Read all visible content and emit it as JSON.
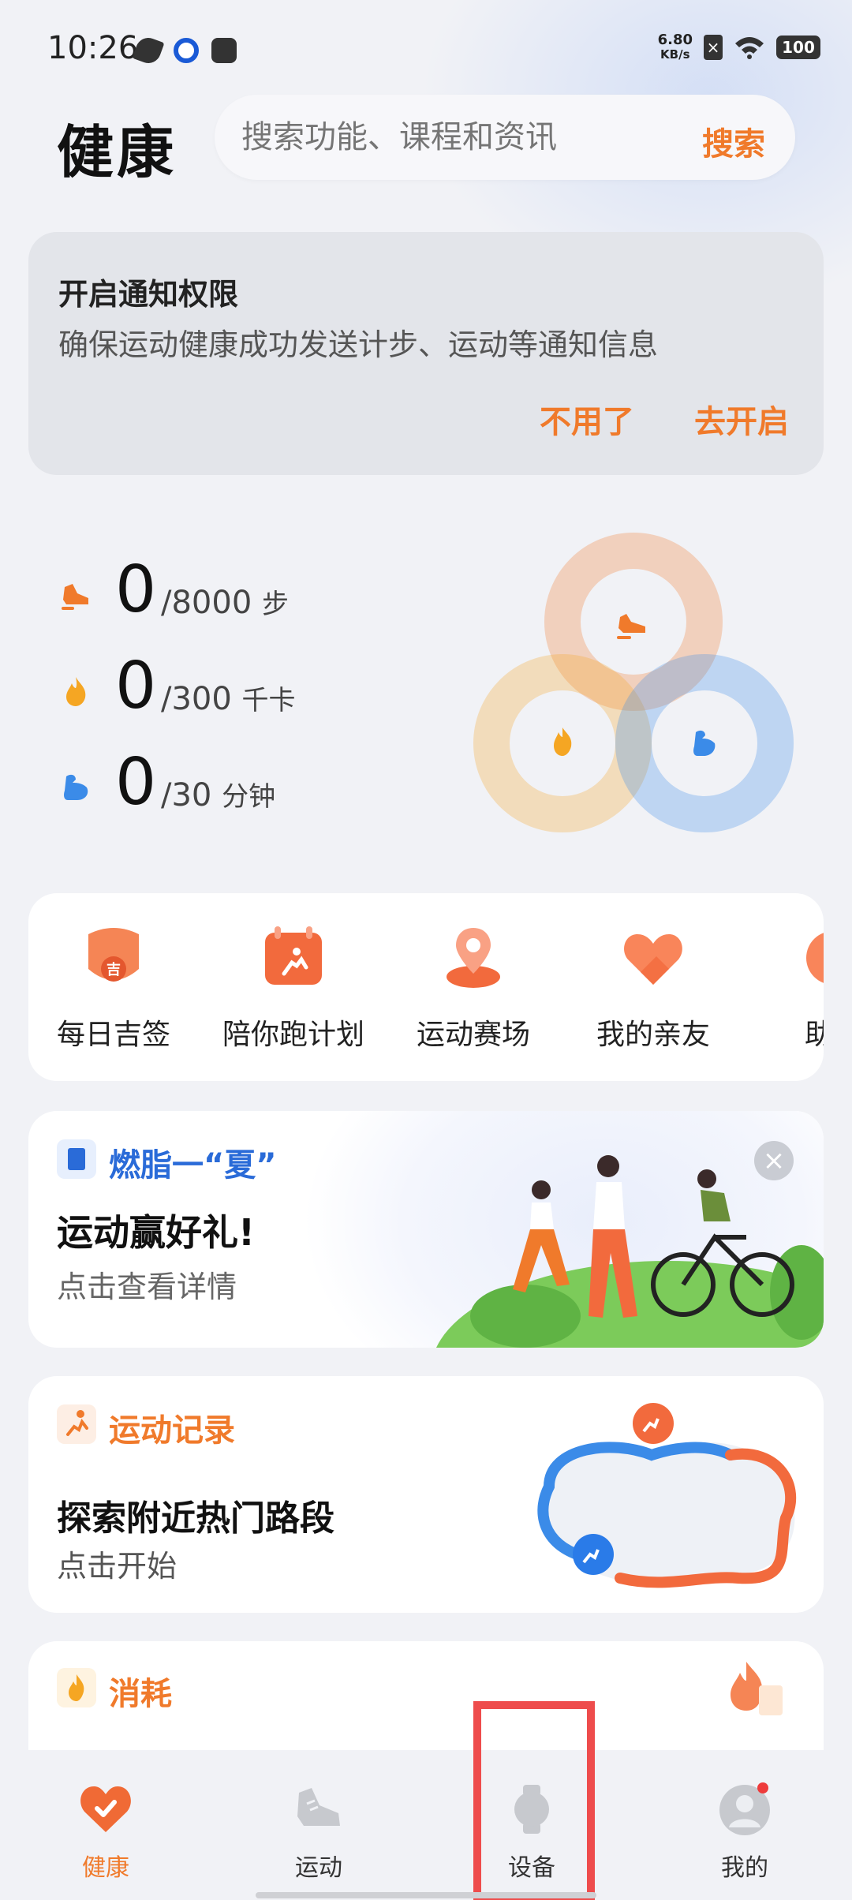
{
  "status_bar": {
    "time": "10:26",
    "net_speed_value": "6.80",
    "net_speed_unit": "KB/s",
    "battery": "100"
  },
  "header": {
    "title": "健康",
    "search_placeholder": "搜索功能、课程和资讯",
    "search_button": "搜索"
  },
  "notice": {
    "title": "开启通知权限",
    "description": "确保运动健康成功发送计步、运动等通知信息",
    "dismiss": "不用了",
    "enable": "去开启"
  },
  "stats": [
    {
      "icon": "shoe-icon",
      "value": "0",
      "goal": "/8000",
      "unit": "步",
      "color": "#f07a2b"
    },
    {
      "icon": "flame-icon",
      "value": "0",
      "goal": "/300",
      "unit": "千卡",
      "color": "#f5a623"
    },
    {
      "icon": "muscle-icon",
      "value": "0",
      "goal": "/30",
      "unit": "分钟",
      "color": "#3b8be8"
    }
  ],
  "shortcuts": [
    {
      "icon": "lucky-sign-icon",
      "label": "每日吉签"
    },
    {
      "icon": "run-plan-icon",
      "label": "陪你跑计划"
    },
    {
      "icon": "arena-icon",
      "label": "运动赛场"
    },
    {
      "icon": "family-heart-icon",
      "label": "我的亲友"
    },
    {
      "icon": "sleep-aid-icon",
      "label": "助眠"
    }
  ],
  "promo": {
    "tag": "燃脂一“夏”",
    "title": "运动赢好礼!",
    "subtitle": "点击查看详情"
  },
  "record": {
    "tag": "运动记录",
    "title": "探索附近热门路段",
    "subtitle": "点击开始"
  },
  "consume": {
    "tag": "消耗"
  },
  "bottom_nav": [
    {
      "icon": "heart-icon",
      "label": "健康",
      "active": true
    },
    {
      "icon": "sneaker-icon",
      "label": "运动",
      "active": false
    },
    {
      "icon": "watch-icon",
      "label": "设备",
      "active": false
    },
    {
      "icon": "profile-icon",
      "label": "我的",
      "active": false
    }
  ],
  "colors": {
    "accent": "#f07a2b",
    "blue": "#2a6bd8",
    "highlight": "#ee4c4c"
  }
}
